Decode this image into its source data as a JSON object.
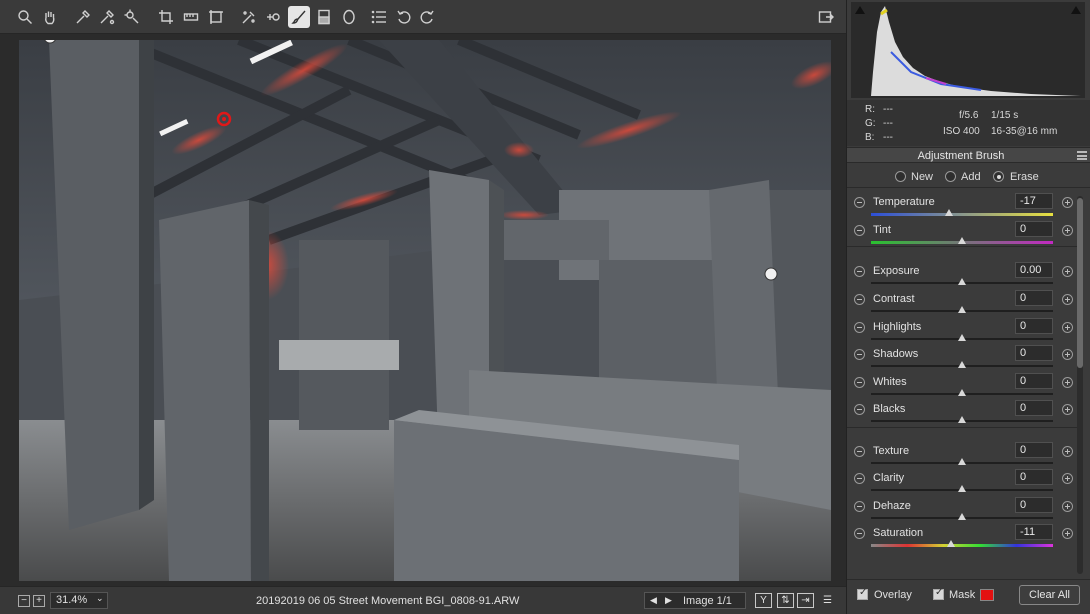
{
  "toolbar": {
    "tools": [
      "zoom-icon",
      "hand-icon",
      "white-balance-icon",
      "color-sampler-icon",
      "target-adjustment-icon",
      "crop-icon",
      "straighten-icon",
      "transform-icon",
      "spot-removal-icon",
      "red-eye-icon",
      "adjustment-brush-icon",
      "graduated-filter-icon",
      "radial-filter-icon",
      "preferences-icon",
      "rotate-left-icon",
      "rotate-right-icon"
    ],
    "active_tool": "adjustment-brush-icon"
  },
  "readout": {
    "r_label": "R:",
    "r_value": "---",
    "g_label": "G:",
    "g_value": "---",
    "b_label": "B:",
    "b_value": "---",
    "aperture": "f/5.6",
    "shutter": "1/15 s",
    "iso": "ISO 400",
    "lens": "16-35@16 mm"
  },
  "panel": {
    "title": "Adjustment Brush",
    "modes": [
      "New",
      "Add",
      "Erase"
    ],
    "selected_mode": "Erase"
  },
  "sliders": [
    {
      "label": "Temperature",
      "value": "-17",
      "position": 0.43
    },
    {
      "label": "Tint",
      "value": "0",
      "position": 0.5
    },
    {
      "label": "Exposure",
      "value": "0.00",
      "position": 0.5
    },
    {
      "label": "Contrast",
      "value": "0",
      "position": 0.5
    },
    {
      "label": "Highlights",
      "value": "0",
      "position": 0.5
    },
    {
      "label": "Shadows",
      "value": "0",
      "position": 0.5
    },
    {
      "label": "Whites",
      "value": "0",
      "position": 0.5
    },
    {
      "label": "Blacks",
      "value": "0",
      "position": 0.5
    },
    {
      "label": "Texture",
      "value": "0",
      "position": 0.5
    },
    {
      "label": "Clarity",
      "value": "0",
      "position": 0.5
    },
    {
      "label": "Dehaze",
      "value": "0",
      "position": 0.5
    },
    {
      "label": "Saturation",
      "value": "-11",
      "position": 0.44
    }
  ],
  "footer": {
    "overlay_label": "Overlay",
    "mask_label": "Mask",
    "mask_color": "#e31010",
    "clear_all_label": "Clear All"
  },
  "bottombar": {
    "zoom_out": "−",
    "zoom_in": "+",
    "zoom": "31.4%",
    "filename": "20192019 06 05 Street Movement BGI_0808-91.ARW",
    "image_counter": "Image 1/1",
    "view_y": "Y"
  },
  "colors": {
    "accent": "#e31010",
    "panel_bg": "#3b3b3b",
    "toolbar_bg": "#3a3a3a"
  }
}
